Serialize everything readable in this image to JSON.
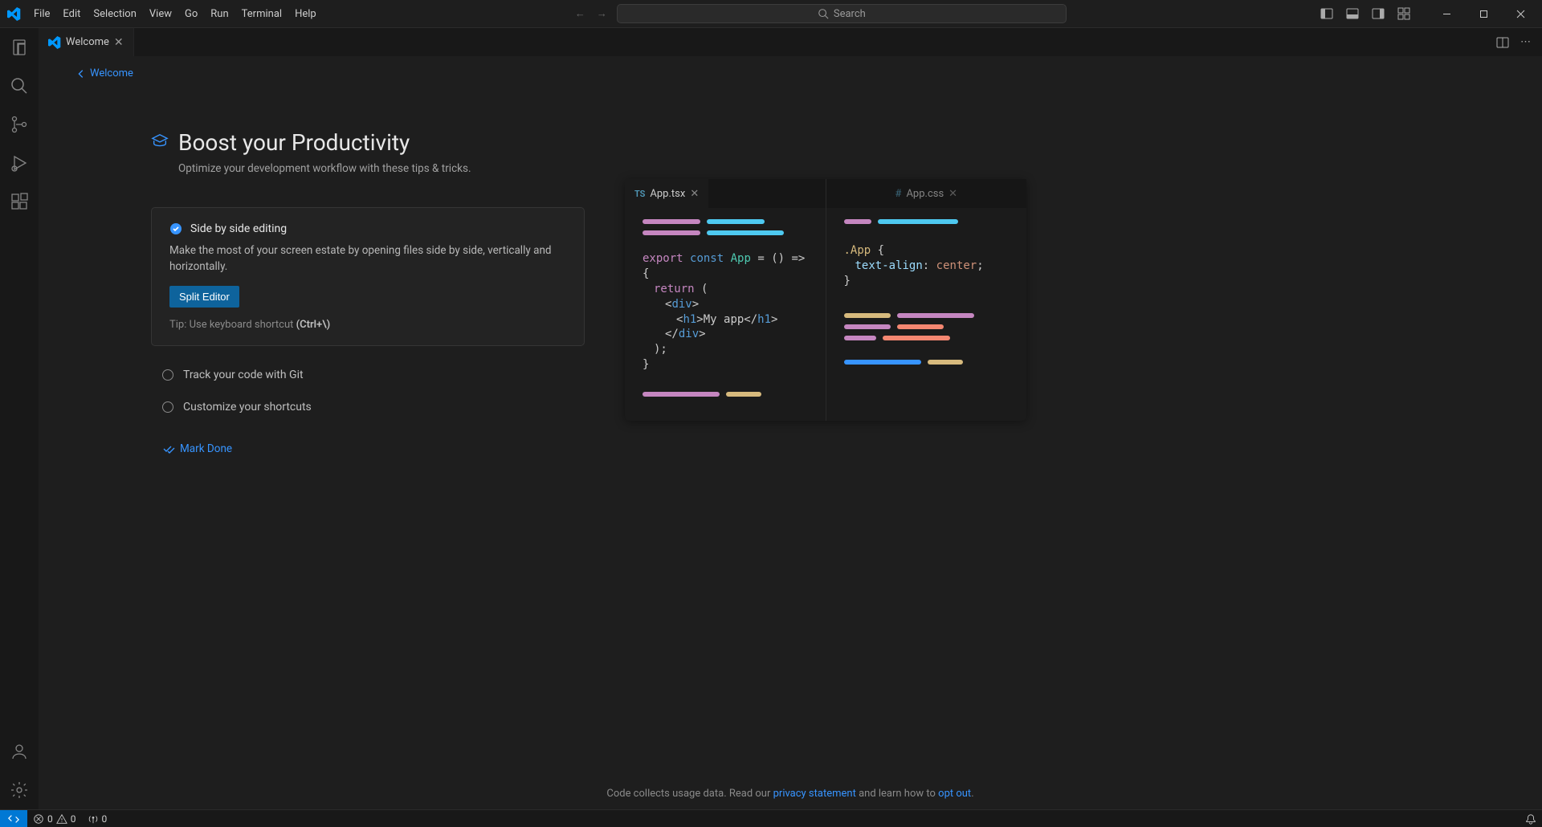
{
  "menus": [
    "File",
    "Edit",
    "Selection",
    "View",
    "Go",
    "Run",
    "Terminal",
    "Help"
  ],
  "search": {
    "placeholder": "Search"
  },
  "tab": {
    "label": "Welcome"
  },
  "breadcrumb": {
    "label": "Welcome"
  },
  "page": {
    "title": "Boost your Productivity",
    "subtitle": "Optimize your development workflow with these tips & tricks."
  },
  "step_open": {
    "title": "Side by side editing",
    "desc": "Make the most of your screen estate by opening files side by side, vertically and horizontally.",
    "button": "Split Editor",
    "tip_prefix": "Tip: Use keyboard shortcut ",
    "tip_shortcut": "(Ctrl+\\)"
  },
  "steps": {
    "track_git": "Track your code with Git",
    "customize": "Customize your shortcuts"
  },
  "mark_done": "Mark Done",
  "illus": {
    "left": {
      "lang": "TS",
      "name": "App.tsx"
    },
    "right": {
      "lang": "#",
      "name": "App.css"
    },
    "code": {
      "line1a": "export",
      "line1b": "const",
      "line1c": "App",
      "line1d": " = () => {",
      "line2a": "return",
      "line2b": " (",
      "line3a": "<",
      "line3b": "div",
      "line3c": ">",
      "line4a": "<",
      "line4b": "h1",
      "line4c": ">My app</",
      "line4d": "h1",
      "line4e": ">",
      "line5a": "</",
      "line5b": "div",
      "line5c": ">",
      "line6": ");",
      "line7": "}",
      "css1": ".App",
      "css1b": " {",
      "css2a": "text-align",
      "css2b": ": ",
      "css2c": "center",
      "css2d": ";",
      "css3": "}"
    }
  },
  "footer": {
    "prefix": "Code collects usage data. Read our ",
    "link1": "privacy statement",
    "mid": " and learn how to ",
    "link2": "opt out",
    "suffix": "."
  },
  "status": {
    "errors": "0",
    "warnings": "0",
    "ports": "0"
  }
}
